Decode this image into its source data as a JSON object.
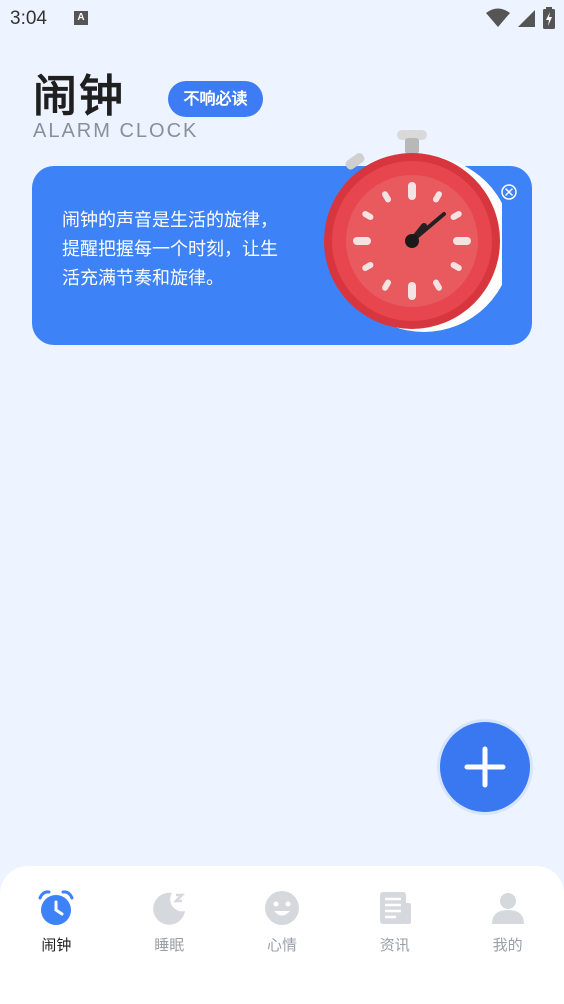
{
  "status_bar": {
    "time": "3:04",
    "notification_letter": "A"
  },
  "header": {
    "title": "闹钟",
    "subtitle": "ALARM CLOCK",
    "must_read_label": "不响必读"
  },
  "banner": {
    "text": "闹钟的声音是生活的旋律，提醒把握每一个时刻，让生活充满节奏和旋律。"
  },
  "tabs": [
    {
      "label": "闹钟",
      "icon": "alarm-clock-icon",
      "active": true
    },
    {
      "label": "睡眠",
      "icon": "moon-icon",
      "active": false
    },
    {
      "label": "心情",
      "icon": "smiley-icon",
      "active": false
    },
    {
      "label": "资讯",
      "icon": "news-icon",
      "active": false
    },
    {
      "label": "我的",
      "icon": "user-icon",
      "active": false
    }
  ],
  "colors": {
    "accent": "#3d82f6",
    "background": "#eef4ff",
    "inactive_icon": "#d5d8dd"
  }
}
